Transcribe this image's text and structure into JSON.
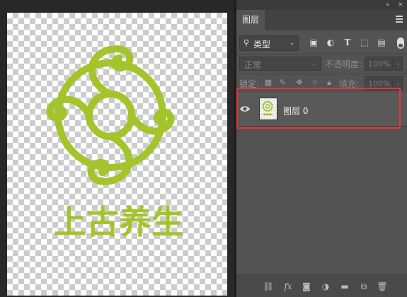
{
  "canvas": {
    "logo_text": "上古养生",
    "logo_color": "#a4c42c"
  },
  "panel": {
    "tab": "图层",
    "menu_icon": "hamburger-icon",
    "collapse_icon": "double-chevron-icon",
    "filter": {
      "search_icon": "search-icon",
      "label": "类型",
      "chevron": "⌄"
    },
    "filter_icons": [
      "image-filter-icon",
      "adjustment-filter-icon",
      "type-filter-icon",
      "shape-filter-icon",
      "smart-object-filter-icon"
    ],
    "blend_mode": "正常",
    "opacity_label": "不透明度:",
    "opacity_value": "100%",
    "lock_label": "锁定:",
    "lock_icons": [
      "lock-transparent-icon",
      "lock-pixels-icon",
      "lock-position-icon",
      "lock-artboard-icon",
      "lock-all-icon"
    ],
    "fill_label": "填充:",
    "fill_value": "100%",
    "layers": [
      {
        "name": "图层 0",
        "visible": true
      }
    ],
    "bottom_icons": [
      "link-icon",
      "fx-icon",
      "mask-icon",
      "adjustment-icon",
      "folder-icon",
      "new-layer-icon",
      "trash-icon"
    ],
    "highlight_color": "#e8353a"
  }
}
